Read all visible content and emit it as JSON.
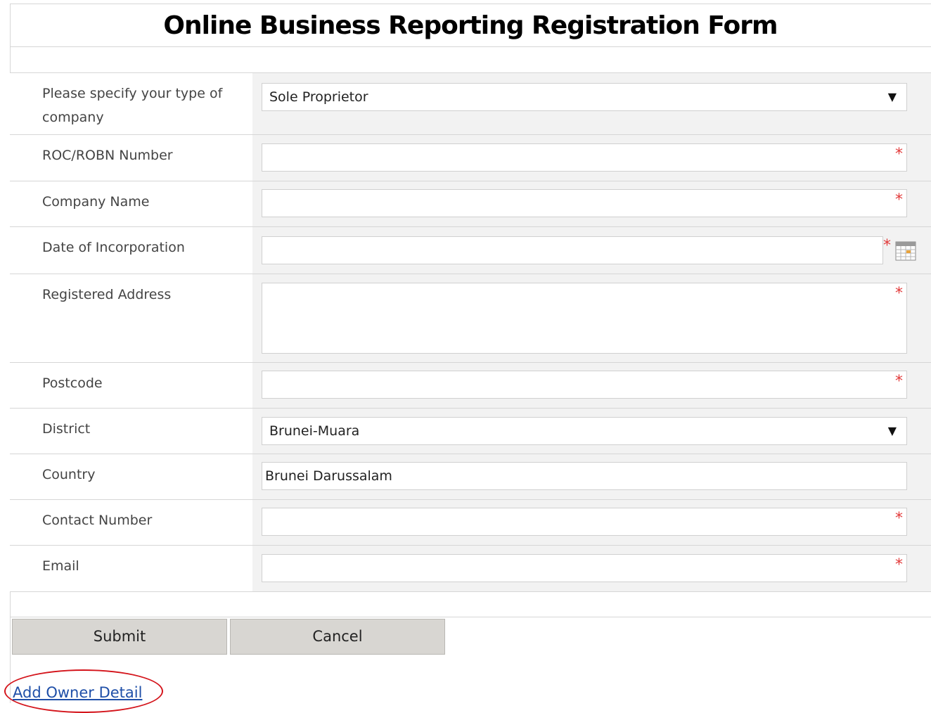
{
  "page": {
    "title": "Online Business Reporting Registration Form"
  },
  "form": {
    "company_type": {
      "label": "Please specify your type of company",
      "value": "Sole Proprietor"
    },
    "roc_robn": {
      "label": "ROC/ROBN Number",
      "value": ""
    },
    "company_name": {
      "label": "Company Name",
      "value": ""
    },
    "incorporation_date": {
      "label": "Date of Incorporation",
      "value": ""
    },
    "registered_address": {
      "label": "Registered Address",
      "value": ""
    },
    "postcode": {
      "label": "Postcode",
      "value": ""
    },
    "district": {
      "label": "District",
      "value": "Brunei-Muara"
    },
    "country": {
      "label": "Country",
      "value": "Brunei Darussalam"
    },
    "contact_number": {
      "label": "Contact Number",
      "value": ""
    },
    "email": {
      "label": "Email",
      "value": ""
    },
    "required_mark": "*"
  },
  "actions": {
    "submit_label": "Submit",
    "cancel_label": "Cancel",
    "add_owner_label": "Add Owner Detail"
  },
  "icons": {
    "dropdown": "dropdown-arrow-icon",
    "calendar": "calendar-icon"
  },
  "colors": {
    "required": "#e23a3a",
    "link": "#1f4fa8",
    "highlight": "#d4141b",
    "row_bg": "#f2f2f2"
  }
}
